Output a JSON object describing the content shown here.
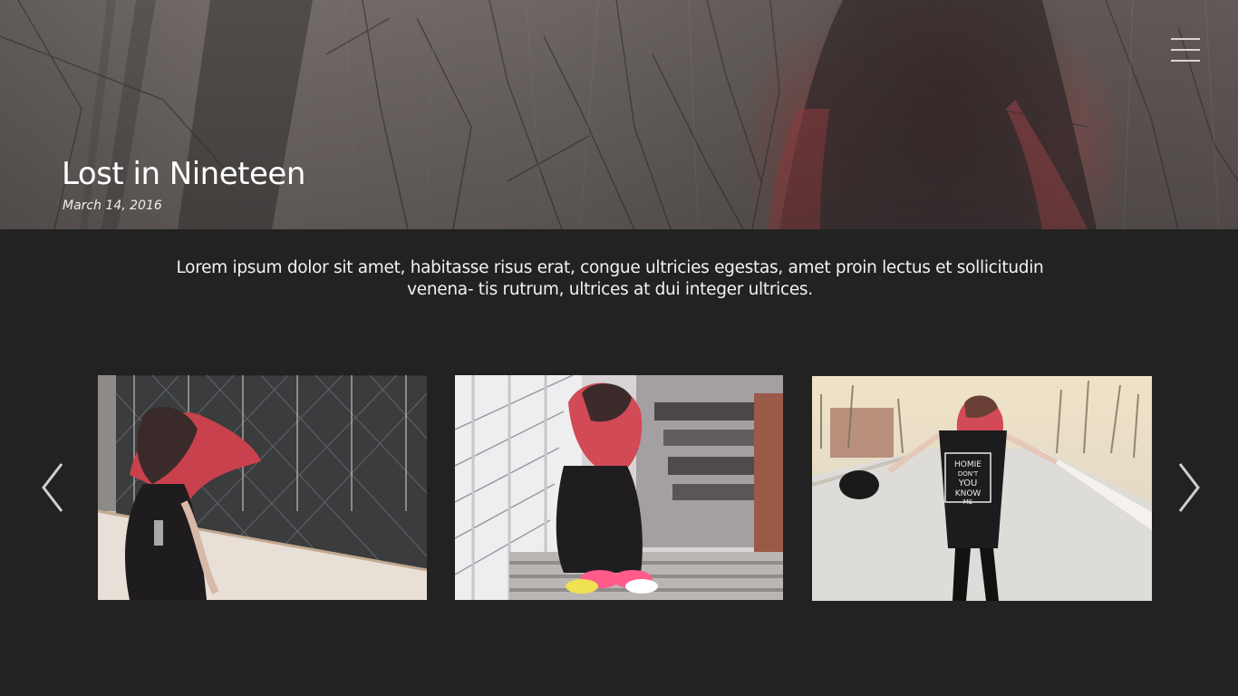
{
  "header": {
    "menu_icon": "hamburger-menu-icon"
  },
  "post": {
    "title": "Lost in Nineteen",
    "date": "March 14, 2016",
    "intro": "Lorem ipsum dolor sit amet, habitasse risus erat, congue ultricies egestas, amet proin lectus et sollicitudin venena- tis rutrum, ultrices at dui integer ultrices."
  },
  "gallery": {
    "prev_icon": "chevron-left-icon",
    "next_icon": "chevron-right-icon",
    "photos": [
      {
        "subject": "girl with red-tipped hair by chain-link fence"
      },
      {
        "subject": "girl crouching on concrete stairs"
      },
      {
        "subject": "girl dancing on road holding cap",
        "shirt_text": "HOMIE DON'T YOU KNOW ME"
      }
    ]
  },
  "colors": {
    "background": "#222222",
    "text": "#ffffff",
    "hair_accent": "#d24a55"
  }
}
